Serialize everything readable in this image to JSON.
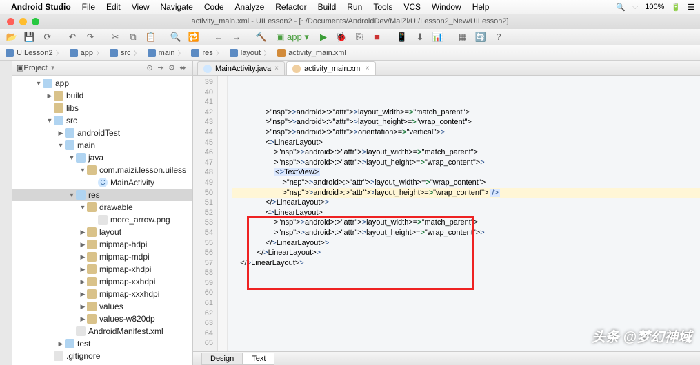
{
  "menubar": {
    "app": "Android Studio",
    "items": [
      "File",
      "Edit",
      "View",
      "Navigate",
      "Code",
      "Analyze",
      "Refactor",
      "Build",
      "Run",
      "Tools",
      "VCS",
      "Window",
      "Help"
    ],
    "battery": "100%"
  },
  "window": {
    "title": "activity_main.xml - UILesson2 - [~/Documents/AndroidDev/MaiZi/UI/Lesson2_New/UILesson2]"
  },
  "breadcrumbs": [
    "UILesson2",
    "app",
    "src",
    "main",
    "res",
    "layout",
    "activity_main.xml"
  ],
  "project": {
    "title": "Project",
    "tree": [
      {
        "d": 2,
        "a": "open",
        "i": "fldr",
        "t": "app",
        "hl": true
      },
      {
        "d": 3,
        "a": "closed",
        "i": "fldr",
        "t": "build"
      },
      {
        "d": 3,
        "a": "none",
        "i": "fldr",
        "t": "libs"
      },
      {
        "d": 3,
        "a": "open",
        "i": "fldr",
        "t": "src",
        "hl": true
      },
      {
        "d": 4,
        "a": "closed",
        "i": "fldr",
        "t": "androidTest",
        "hl": true
      },
      {
        "d": 4,
        "a": "open",
        "i": "fldr",
        "t": "main",
        "hl": true
      },
      {
        "d": 5,
        "a": "open",
        "i": "fldr",
        "t": "java",
        "hl": true
      },
      {
        "d": 6,
        "a": "open",
        "i": "fldr",
        "t": "com.maizi.lesson.uiless"
      },
      {
        "d": 7,
        "a": "none",
        "i": "cls",
        "t": "MainActivity"
      },
      {
        "d": 5,
        "a": "open",
        "i": "fldr",
        "t": "res",
        "hl": true,
        "sel": true
      },
      {
        "d": 6,
        "a": "open",
        "i": "fldr",
        "t": "drawable"
      },
      {
        "d": 7,
        "a": "none",
        "i": "img",
        "t": "more_arrow.png"
      },
      {
        "d": 6,
        "a": "closed",
        "i": "fldr",
        "t": "layout"
      },
      {
        "d": 6,
        "a": "closed",
        "i": "fldr",
        "t": "mipmap-hdpi"
      },
      {
        "d": 6,
        "a": "closed",
        "i": "fldr",
        "t": "mipmap-mdpi"
      },
      {
        "d": 6,
        "a": "closed",
        "i": "fldr",
        "t": "mipmap-xhdpi"
      },
      {
        "d": 6,
        "a": "closed",
        "i": "fldr",
        "t": "mipmap-xxhdpi"
      },
      {
        "d": 6,
        "a": "closed",
        "i": "fldr",
        "t": "mipmap-xxxhdpi"
      },
      {
        "d": 6,
        "a": "closed",
        "i": "fldr",
        "t": "values"
      },
      {
        "d": 6,
        "a": "closed",
        "i": "fldr",
        "t": "values-w820dp"
      },
      {
        "d": 5,
        "a": "none",
        "i": "file",
        "t": "AndroidManifest.xml"
      },
      {
        "d": 4,
        "a": "closed",
        "i": "fldr",
        "t": "test",
        "hl": true
      },
      {
        "d": 3,
        "a": "none",
        "i": "file",
        "t": ".gitignore"
      }
    ]
  },
  "tabs": [
    {
      "label": "MainActivity.java",
      "icon": "j",
      "active": false
    },
    {
      "label": "activity_main.xml",
      "icon": "x",
      "active": true
    }
  ],
  "editor": {
    "first_line": 39,
    "lines": [
      {
        "indent": 4,
        "raw": "android:layout_width=\"match_parent\""
      },
      {
        "indent": 4,
        "raw": "android:layout_height=\"wrap_content\""
      },
      {
        "indent": 4,
        "raw": "android:orientation=\"vertical\">"
      },
      {
        "indent": 0,
        "raw": ""
      },
      {
        "indent": 4,
        "raw": "<LinearLayout"
      },
      {
        "indent": 5,
        "raw": "android:layout_width=\"match_parent\""
      },
      {
        "indent": 5,
        "raw": "android:layout_height=\"wrap_content\">"
      },
      {
        "indent": 0,
        "raw": ""
      },
      {
        "indent": 5,
        "raw": "<TextView",
        "hl": "tag"
      },
      {
        "indent": 6,
        "raw": "android:layout_width=\"wrap_content\""
      },
      {
        "indent": 6,
        "raw": "android:layout_height=\"wrap_content\" />",
        "cursor": true
      },
      {
        "indent": 0,
        "raw": ""
      },
      {
        "indent": 4,
        "raw": "</LinearLayout>"
      },
      {
        "indent": 0,
        "raw": ""
      },
      {
        "indent": 4,
        "raw": "<LinearLayout"
      },
      {
        "indent": 5,
        "raw": "android:layout_width=\"match_parent\""
      },
      {
        "indent": 5,
        "raw": "android:layout_height=\"wrap_content\">"
      },
      {
        "indent": 0,
        "raw": ""
      },
      {
        "indent": 0,
        "raw": ""
      },
      {
        "indent": 4,
        "raw": "</LinearLayout>"
      },
      {
        "indent": 0,
        "raw": ""
      },
      {
        "indent": 3,
        "raw": "</LinearLayout>"
      },
      {
        "indent": 0,
        "raw": ""
      },
      {
        "indent": 0,
        "raw": ""
      },
      {
        "indent": 0,
        "raw": ""
      },
      {
        "indent": 0,
        "raw": ""
      },
      {
        "indent": 1,
        "raw": "</LinearLayout>"
      }
    ],
    "bottom_tabs": [
      "Design",
      "Text"
    ],
    "bottom_active": 1,
    "redbox": {
      "top_line": 53,
      "bottom_line": 59
    }
  },
  "watermark": "头条 @梦幻神域"
}
